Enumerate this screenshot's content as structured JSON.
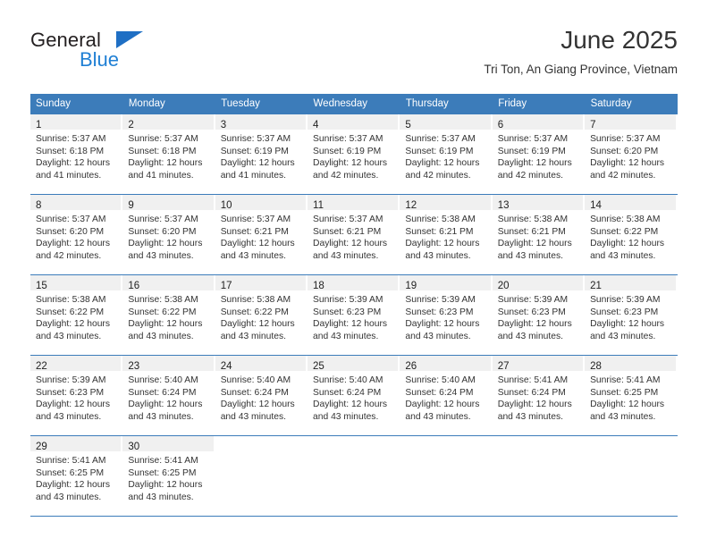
{
  "logo": {
    "word_one": "General",
    "word_two": "Blue",
    "triangle_icon": "triangle-icon",
    "colors": {
      "dark": "#231f20",
      "blue": "#1f7fd4"
    }
  },
  "header": {
    "title": "June 2025",
    "location": "Tri Ton, An Giang Province, Vietnam"
  },
  "colors": {
    "header_blue": "#3c7cba",
    "daynum_band": "#f0f0f0",
    "text": "#333333"
  },
  "weekday_headers": [
    "Sunday",
    "Monday",
    "Tuesday",
    "Wednesday",
    "Thursday",
    "Friday",
    "Saturday"
  ],
  "weeks": [
    [
      {
        "day": "1",
        "sunrise": "Sunrise: 5:37 AM",
        "sunset": "Sunset: 6:18 PM",
        "daylight_1": "Daylight: 12 hours",
        "daylight_2": "and 41 minutes."
      },
      {
        "day": "2",
        "sunrise": "Sunrise: 5:37 AM",
        "sunset": "Sunset: 6:18 PM",
        "daylight_1": "Daylight: 12 hours",
        "daylight_2": "and 41 minutes."
      },
      {
        "day": "3",
        "sunrise": "Sunrise: 5:37 AM",
        "sunset": "Sunset: 6:19 PM",
        "daylight_1": "Daylight: 12 hours",
        "daylight_2": "and 41 minutes."
      },
      {
        "day": "4",
        "sunrise": "Sunrise: 5:37 AM",
        "sunset": "Sunset: 6:19 PM",
        "daylight_1": "Daylight: 12 hours",
        "daylight_2": "and 42 minutes."
      },
      {
        "day": "5",
        "sunrise": "Sunrise: 5:37 AM",
        "sunset": "Sunset: 6:19 PM",
        "daylight_1": "Daylight: 12 hours",
        "daylight_2": "and 42 minutes."
      },
      {
        "day": "6",
        "sunrise": "Sunrise: 5:37 AM",
        "sunset": "Sunset: 6:19 PM",
        "daylight_1": "Daylight: 12 hours",
        "daylight_2": "and 42 minutes."
      },
      {
        "day": "7",
        "sunrise": "Sunrise: 5:37 AM",
        "sunset": "Sunset: 6:20 PM",
        "daylight_1": "Daylight: 12 hours",
        "daylight_2": "and 42 minutes."
      }
    ],
    [
      {
        "day": "8",
        "sunrise": "Sunrise: 5:37 AM",
        "sunset": "Sunset: 6:20 PM",
        "daylight_1": "Daylight: 12 hours",
        "daylight_2": "and 42 minutes."
      },
      {
        "day": "9",
        "sunrise": "Sunrise: 5:37 AM",
        "sunset": "Sunset: 6:20 PM",
        "daylight_1": "Daylight: 12 hours",
        "daylight_2": "and 43 minutes."
      },
      {
        "day": "10",
        "sunrise": "Sunrise: 5:37 AM",
        "sunset": "Sunset: 6:21 PM",
        "daylight_1": "Daylight: 12 hours",
        "daylight_2": "and 43 minutes."
      },
      {
        "day": "11",
        "sunrise": "Sunrise: 5:37 AM",
        "sunset": "Sunset: 6:21 PM",
        "daylight_1": "Daylight: 12 hours",
        "daylight_2": "and 43 minutes."
      },
      {
        "day": "12",
        "sunrise": "Sunrise: 5:38 AM",
        "sunset": "Sunset: 6:21 PM",
        "daylight_1": "Daylight: 12 hours",
        "daylight_2": "and 43 minutes."
      },
      {
        "day": "13",
        "sunrise": "Sunrise: 5:38 AM",
        "sunset": "Sunset: 6:21 PM",
        "daylight_1": "Daylight: 12 hours",
        "daylight_2": "and 43 minutes."
      },
      {
        "day": "14",
        "sunrise": "Sunrise: 5:38 AM",
        "sunset": "Sunset: 6:22 PM",
        "daylight_1": "Daylight: 12 hours",
        "daylight_2": "and 43 minutes."
      }
    ],
    [
      {
        "day": "15",
        "sunrise": "Sunrise: 5:38 AM",
        "sunset": "Sunset: 6:22 PM",
        "daylight_1": "Daylight: 12 hours",
        "daylight_2": "and 43 minutes."
      },
      {
        "day": "16",
        "sunrise": "Sunrise: 5:38 AM",
        "sunset": "Sunset: 6:22 PM",
        "daylight_1": "Daylight: 12 hours",
        "daylight_2": "and 43 minutes."
      },
      {
        "day": "17",
        "sunrise": "Sunrise: 5:38 AM",
        "sunset": "Sunset: 6:22 PM",
        "daylight_1": "Daylight: 12 hours",
        "daylight_2": "and 43 minutes."
      },
      {
        "day": "18",
        "sunrise": "Sunrise: 5:39 AM",
        "sunset": "Sunset: 6:23 PM",
        "daylight_1": "Daylight: 12 hours",
        "daylight_2": "and 43 minutes."
      },
      {
        "day": "19",
        "sunrise": "Sunrise: 5:39 AM",
        "sunset": "Sunset: 6:23 PM",
        "daylight_1": "Daylight: 12 hours",
        "daylight_2": "and 43 minutes."
      },
      {
        "day": "20",
        "sunrise": "Sunrise: 5:39 AM",
        "sunset": "Sunset: 6:23 PM",
        "daylight_1": "Daylight: 12 hours",
        "daylight_2": "and 43 minutes."
      },
      {
        "day": "21",
        "sunrise": "Sunrise: 5:39 AM",
        "sunset": "Sunset: 6:23 PM",
        "daylight_1": "Daylight: 12 hours",
        "daylight_2": "and 43 minutes."
      }
    ],
    [
      {
        "day": "22",
        "sunrise": "Sunrise: 5:39 AM",
        "sunset": "Sunset: 6:23 PM",
        "daylight_1": "Daylight: 12 hours",
        "daylight_2": "and 43 minutes."
      },
      {
        "day": "23",
        "sunrise": "Sunrise: 5:40 AM",
        "sunset": "Sunset: 6:24 PM",
        "daylight_1": "Daylight: 12 hours",
        "daylight_2": "and 43 minutes."
      },
      {
        "day": "24",
        "sunrise": "Sunrise: 5:40 AM",
        "sunset": "Sunset: 6:24 PM",
        "daylight_1": "Daylight: 12 hours",
        "daylight_2": "and 43 minutes."
      },
      {
        "day": "25",
        "sunrise": "Sunrise: 5:40 AM",
        "sunset": "Sunset: 6:24 PM",
        "daylight_1": "Daylight: 12 hours",
        "daylight_2": "and 43 minutes."
      },
      {
        "day": "26",
        "sunrise": "Sunrise: 5:40 AM",
        "sunset": "Sunset: 6:24 PM",
        "daylight_1": "Daylight: 12 hours",
        "daylight_2": "and 43 minutes."
      },
      {
        "day": "27",
        "sunrise": "Sunrise: 5:41 AM",
        "sunset": "Sunset: 6:24 PM",
        "daylight_1": "Daylight: 12 hours",
        "daylight_2": "and 43 minutes."
      },
      {
        "day": "28",
        "sunrise": "Sunrise: 5:41 AM",
        "sunset": "Sunset: 6:25 PM",
        "daylight_1": "Daylight: 12 hours",
        "daylight_2": "and 43 minutes."
      }
    ],
    [
      {
        "day": "29",
        "sunrise": "Sunrise: 5:41 AM",
        "sunset": "Sunset: 6:25 PM",
        "daylight_1": "Daylight: 12 hours",
        "daylight_2": "and 43 minutes."
      },
      {
        "day": "30",
        "sunrise": "Sunrise: 5:41 AM",
        "sunset": "Sunset: 6:25 PM",
        "daylight_1": "Daylight: 12 hours",
        "daylight_2": "and 43 minutes."
      },
      {
        "day": "",
        "sunrise": "",
        "sunset": "",
        "daylight_1": "",
        "daylight_2": ""
      },
      {
        "day": "",
        "sunrise": "",
        "sunset": "",
        "daylight_1": "",
        "daylight_2": ""
      },
      {
        "day": "",
        "sunrise": "",
        "sunset": "",
        "daylight_1": "",
        "daylight_2": ""
      },
      {
        "day": "",
        "sunrise": "",
        "sunset": "",
        "daylight_1": "",
        "daylight_2": ""
      },
      {
        "day": "",
        "sunrise": "",
        "sunset": "",
        "daylight_1": "",
        "daylight_2": ""
      }
    ]
  ]
}
